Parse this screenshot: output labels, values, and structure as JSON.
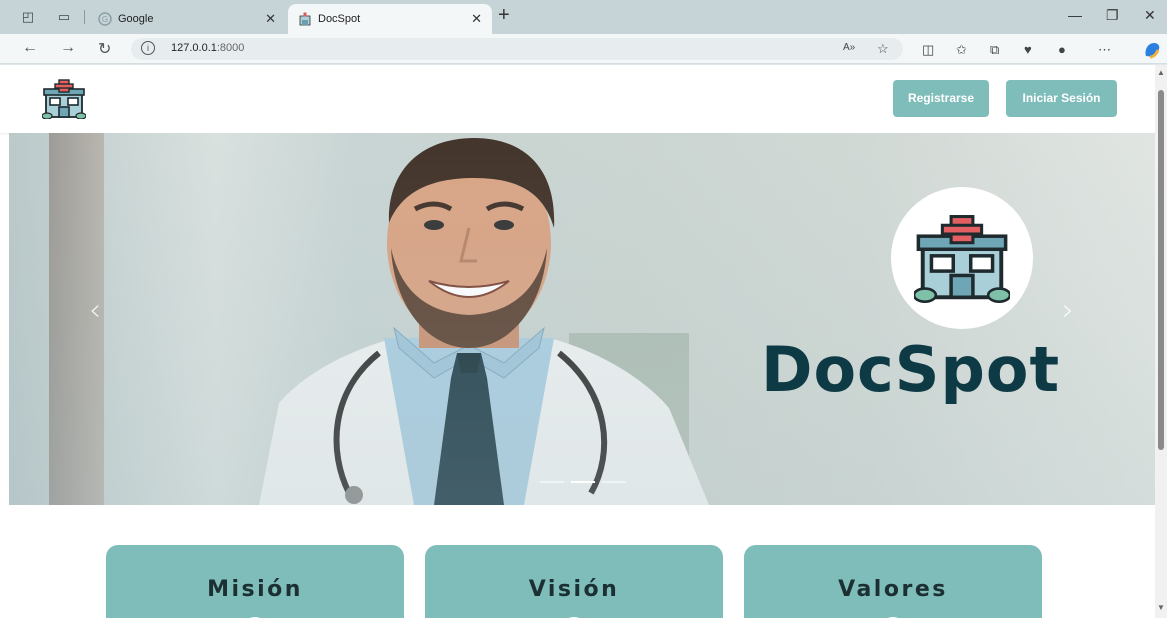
{
  "browser": {
    "tabs": [
      {
        "label": "Google",
        "active": false
      },
      {
        "label": "DocSpot",
        "active": true
      }
    ],
    "url_host": "127.0.0.1",
    "url_port": ":8000"
  },
  "header": {
    "register_label": "Registrarse",
    "login_label": "Iniciar Sesión"
  },
  "hero": {
    "brand": "DocSpot",
    "prev_glyph": "‹",
    "next_glyph": "›",
    "slides": 3,
    "active_slide": 2
  },
  "cards": [
    {
      "title": "Misión"
    },
    {
      "title": "Visión"
    },
    {
      "title": "Valores"
    }
  ],
  "colors": {
    "accent": "#7fbdba",
    "brand_text": "#0e3a45"
  }
}
